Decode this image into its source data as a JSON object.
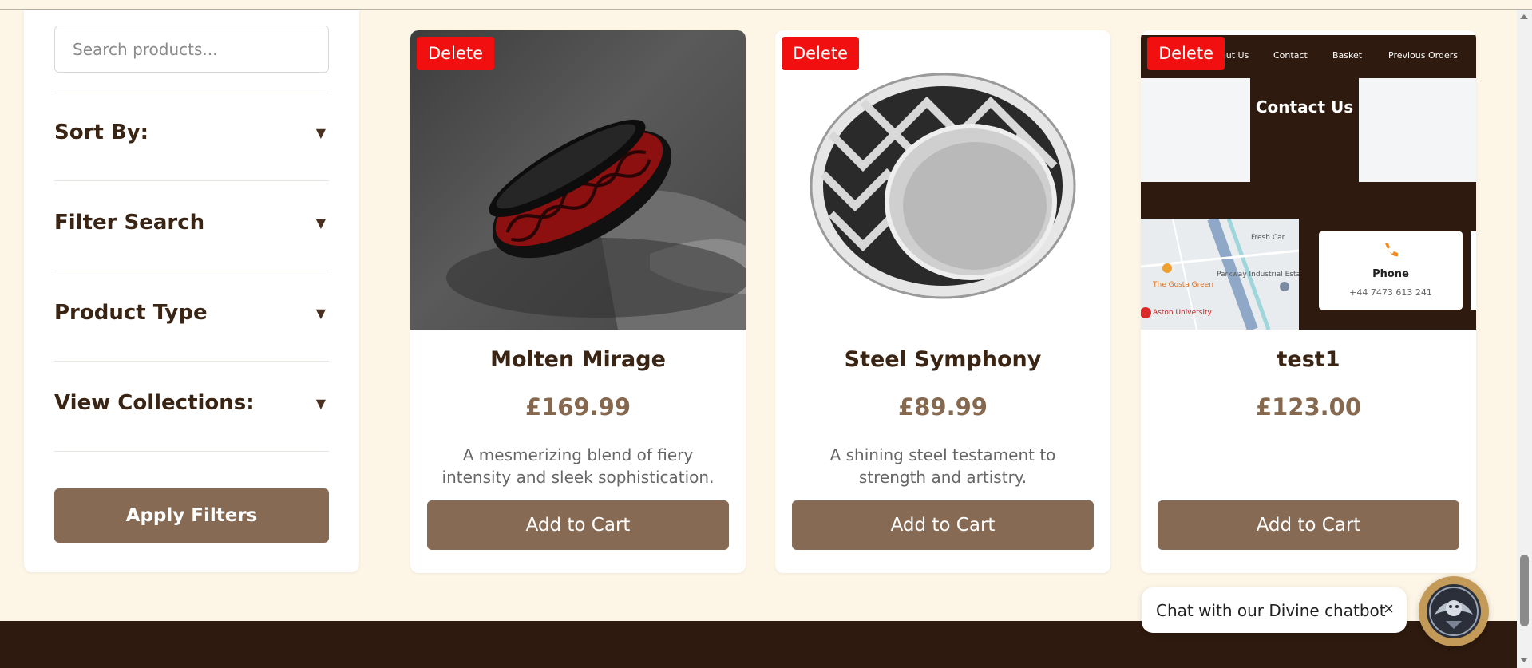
{
  "sidebar": {
    "search_placeholder": "Search products...",
    "filters": [
      {
        "label": "Sort By:",
        "arrow": "▼"
      },
      {
        "label": "Filter Search",
        "arrow": "▼"
      },
      {
        "label": "Product Type",
        "arrow": "▼"
      },
      {
        "label": "View Collections:",
        "arrow": "▼"
      }
    ],
    "apply_label": "Apply Filters"
  },
  "products": [
    {
      "name": "Molten Mirage",
      "price": "£169.99",
      "description": "A mesmerizing blend of fiery intensity and sleek sophistication.",
      "delete_label": "Delete",
      "cart_label": "Add to Cart"
    },
    {
      "name": "Steel Symphony",
      "price": "£89.99",
      "description": "A shining steel testament to strength and artistry.",
      "delete_label": "Delete",
      "cart_label": "Add to Cart"
    },
    {
      "name": "test1",
      "price": "£123.00",
      "description": "",
      "delete_label": "Delete",
      "cart_label": "Add to Cart"
    }
  ],
  "embedded_screenshot": {
    "nav": [
      "out Us",
      "Contact",
      "Basket",
      "Previous Orders"
    ],
    "hero_title": "Contact Us",
    "phone_title": "Phone",
    "phone_number": "+44 7473 613 241",
    "map_labels": [
      "The Gosta Green",
      "Aston University",
      "Parkway Industrial Estate",
      "Fresh Car"
    ]
  },
  "chat": {
    "text": "Chat with our Divine chatbot",
    "close": "×"
  },
  "colors": {
    "background": "#fdf5e6",
    "button": "#876a54",
    "delete": "#f20f0f",
    "dark_brown": "#2e1a0e",
    "price": "#86684f"
  }
}
